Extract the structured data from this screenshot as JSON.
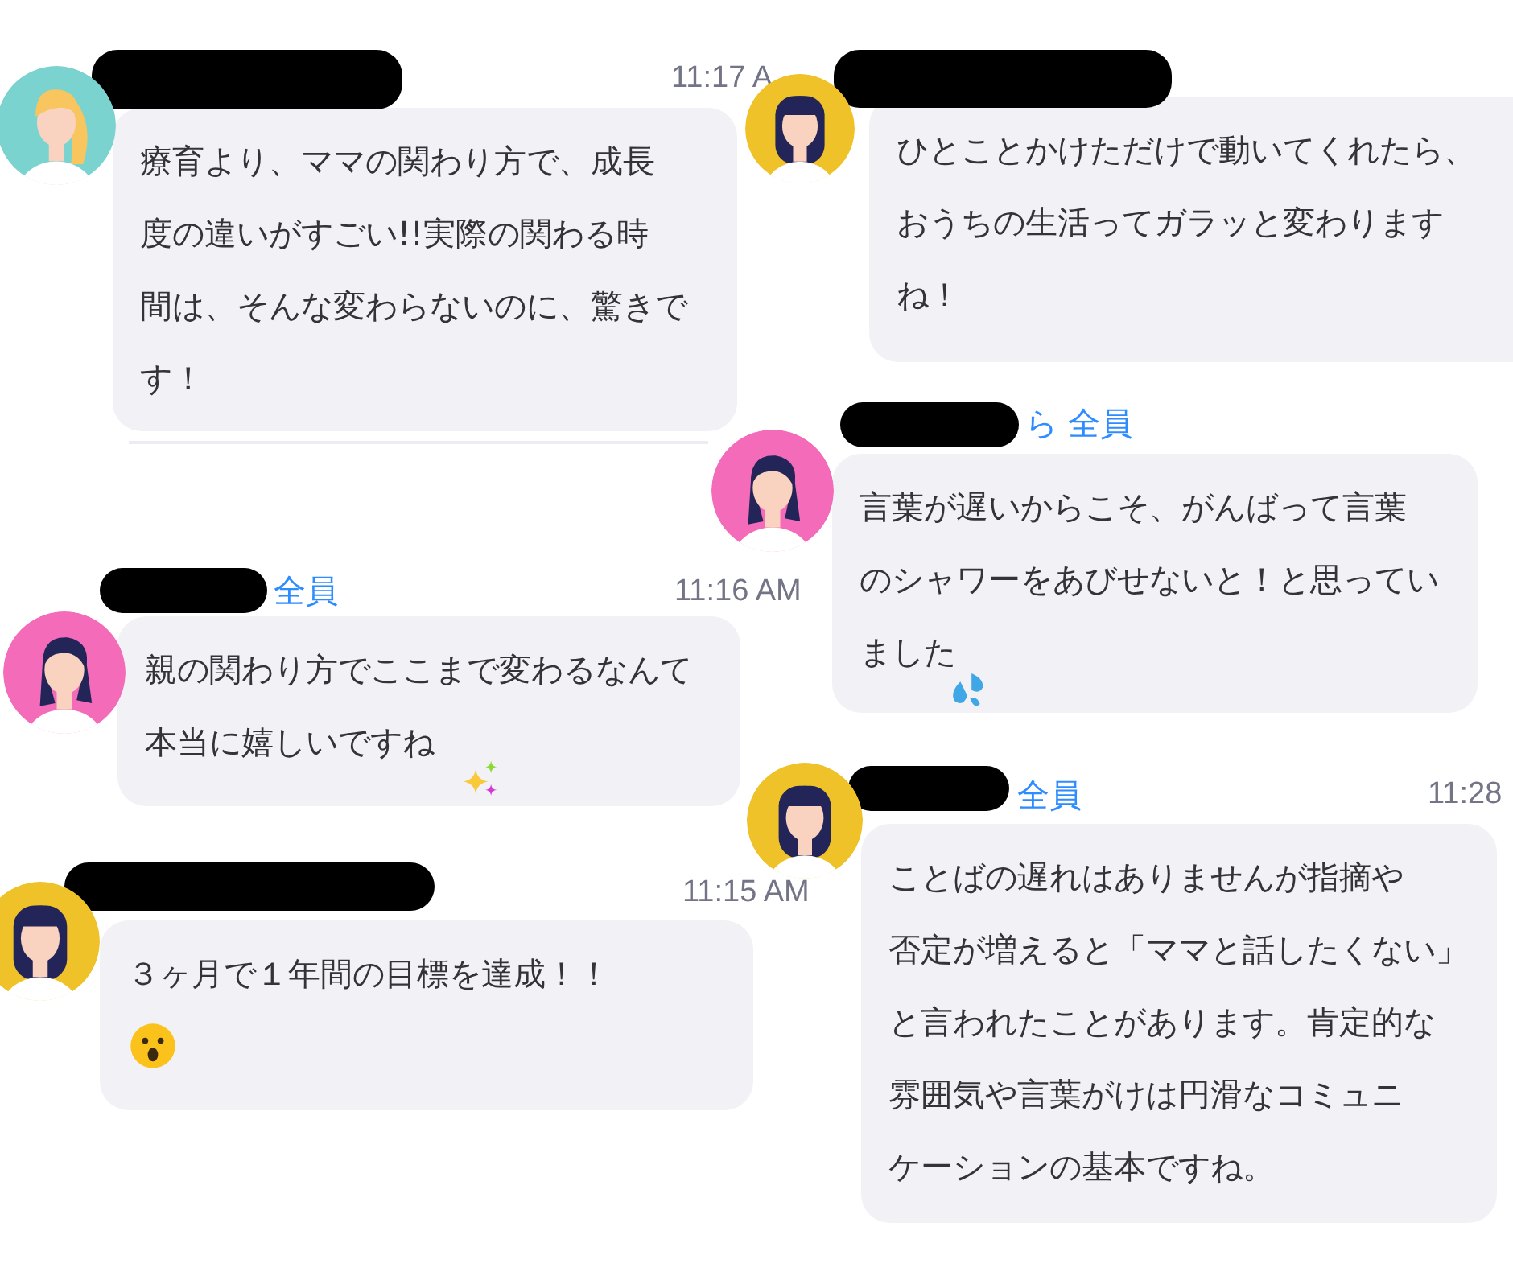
{
  "messages": [
    {
      "time": "11:17 A",
      "avatar": {
        "color": "#7ad3cf"
      },
      "text": "療育より、ママの関わり方で、成長度の違いがすごい!!実際の関わる時間は、そんな変わらないのに、驚きです！"
    },
    {
      "avatar": {
        "color": "#efc22a"
      },
      "text": "ひとことかけただけで動いてくれたら、おうちの生活ってガラッと変わりますね！"
    },
    {
      "recipient": "ら 全員",
      "avatar": {
        "color": "#f46bb9"
      },
      "text": "言葉が遅いからこそ、がんばって言葉のシャワーをあびせないと！と思っていました"
    },
    {
      "recipient": "全員",
      "time": "11:16 AM",
      "avatar": {
        "color": "#f46bb9"
      },
      "text": "親の関わり方でここまで変わるなんて本当に嬉しいですね"
    },
    {
      "recipient": "全員",
      "time": "11:28",
      "avatar": {
        "color": "#efc22a"
      },
      "text": "ことばの遅れはありませんが指摘や否定が増えると「ママと話したくない」と言われたことがあります。肯定的な雰囲気や言葉がけは円滑なコミュニケーションの基本ですね。"
    },
    {
      "time": "11:15 AM",
      "avatar": {
        "color": "#efc22a"
      },
      "text": "３ヶ月で１年間の目標を達成！！"
    }
  ]
}
